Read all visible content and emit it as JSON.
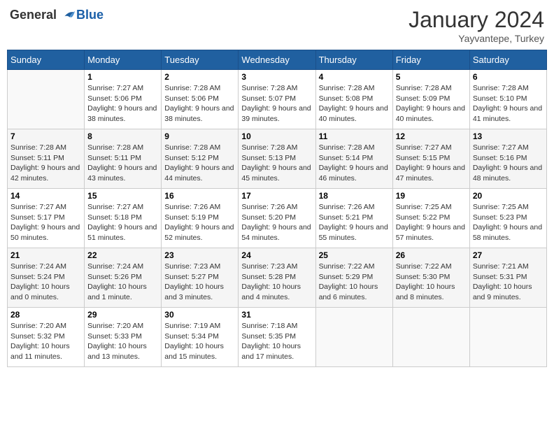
{
  "header": {
    "logo_general": "General",
    "logo_blue": "Blue",
    "month_title": "January 2024",
    "location": "Yayvantepe, Turkey"
  },
  "weekdays": [
    "Sunday",
    "Monday",
    "Tuesday",
    "Wednesday",
    "Thursday",
    "Friday",
    "Saturday"
  ],
  "weeks": [
    [
      {
        "day": "",
        "info": ""
      },
      {
        "day": "1",
        "info": "Sunrise: 7:27 AM\nSunset: 5:06 PM\nDaylight: 9 hours and 38 minutes."
      },
      {
        "day": "2",
        "info": "Sunrise: 7:28 AM\nSunset: 5:06 PM\nDaylight: 9 hours and 38 minutes."
      },
      {
        "day": "3",
        "info": "Sunrise: 7:28 AM\nSunset: 5:07 PM\nDaylight: 9 hours and 39 minutes."
      },
      {
        "day": "4",
        "info": "Sunrise: 7:28 AM\nSunset: 5:08 PM\nDaylight: 9 hours and 40 minutes."
      },
      {
        "day": "5",
        "info": "Sunrise: 7:28 AM\nSunset: 5:09 PM\nDaylight: 9 hours and 40 minutes."
      },
      {
        "day": "6",
        "info": "Sunrise: 7:28 AM\nSunset: 5:10 PM\nDaylight: 9 hours and 41 minutes."
      }
    ],
    [
      {
        "day": "7",
        "info": "Sunrise: 7:28 AM\nSunset: 5:11 PM\nDaylight: 9 hours and 42 minutes."
      },
      {
        "day": "8",
        "info": "Sunrise: 7:28 AM\nSunset: 5:11 PM\nDaylight: 9 hours and 43 minutes."
      },
      {
        "day": "9",
        "info": "Sunrise: 7:28 AM\nSunset: 5:12 PM\nDaylight: 9 hours and 44 minutes."
      },
      {
        "day": "10",
        "info": "Sunrise: 7:28 AM\nSunset: 5:13 PM\nDaylight: 9 hours and 45 minutes."
      },
      {
        "day": "11",
        "info": "Sunrise: 7:28 AM\nSunset: 5:14 PM\nDaylight: 9 hours and 46 minutes."
      },
      {
        "day": "12",
        "info": "Sunrise: 7:27 AM\nSunset: 5:15 PM\nDaylight: 9 hours and 47 minutes."
      },
      {
        "day": "13",
        "info": "Sunrise: 7:27 AM\nSunset: 5:16 PM\nDaylight: 9 hours and 48 minutes."
      }
    ],
    [
      {
        "day": "14",
        "info": "Sunrise: 7:27 AM\nSunset: 5:17 PM\nDaylight: 9 hours and 50 minutes."
      },
      {
        "day": "15",
        "info": "Sunrise: 7:27 AM\nSunset: 5:18 PM\nDaylight: 9 hours and 51 minutes."
      },
      {
        "day": "16",
        "info": "Sunrise: 7:26 AM\nSunset: 5:19 PM\nDaylight: 9 hours and 52 minutes."
      },
      {
        "day": "17",
        "info": "Sunrise: 7:26 AM\nSunset: 5:20 PM\nDaylight: 9 hours and 54 minutes."
      },
      {
        "day": "18",
        "info": "Sunrise: 7:26 AM\nSunset: 5:21 PM\nDaylight: 9 hours and 55 minutes."
      },
      {
        "day": "19",
        "info": "Sunrise: 7:25 AM\nSunset: 5:22 PM\nDaylight: 9 hours and 57 minutes."
      },
      {
        "day": "20",
        "info": "Sunrise: 7:25 AM\nSunset: 5:23 PM\nDaylight: 9 hours and 58 minutes."
      }
    ],
    [
      {
        "day": "21",
        "info": "Sunrise: 7:24 AM\nSunset: 5:24 PM\nDaylight: 10 hours and 0 minutes."
      },
      {
        "day": "22",
        "info": "Sunrise: 7:24 AM\nSunset: 5:26 PM\nDaylight: 10 hours and 1 minute."
      },
      {
        "day": "23",
        "info": "Sunrise: 7:23 AM\nSunset: 5:27 PM\nDaylight: 10 hours and 3 minutes."
      },
      {
        "day": "24",
        "info": "Sunrise: 7:23 AM\nSunset: 5:28 PM\nDaylight: 10 hours and 4 minutes."
      },
      {
        "day": "25",
        "info": "Sunrise: 7:22 AM\nSunset: 5:29 PM\nDaylight: 10 hours and 6 minutes."
      },
      {
        "day": "26",
        "info": "Sunrise: 7:22 AM\nSunset: 5:30 PM\nDaylight: 10 hours and 8 minutes."
      },
      {
        "day": "27",
        "info": "Sunrise: 7:21 AM\nSunset: 5:31 PM\nDaylight: 10 hours and 9 minutes."
      }
    ],
    [
      {
        "day": "28",
        "info": "Sunrise: 7:20 AM\nSunset: 5:32 PM\nDaylight: 10 hours and 11 minutes."
      },
      {
        "day": "29",
        "info": "Sunrise: 7:20 AM\nSunset: 5:33 PM\nDaylight: 10 hours and 13 minutes."
      },
      {
        "day": "30",
        "info": "Sunrise: 7:19 AM\nSunset: 5:34 PM\nDaylight: 10 hours and 15 minutes."
      },
      {
        "day": "31",
        "info": "Sunrise: 7:18 AM\nSunset: 5:35 PM\nDaylight: 10 hours and 17 minutes."
      },
      {
        "day": "",
        "info": ""
      },
      {
        "day": "",
        "info": ""
      },
      {
        "day": "",
        "info": ""
      }
    ]
  ]
}
